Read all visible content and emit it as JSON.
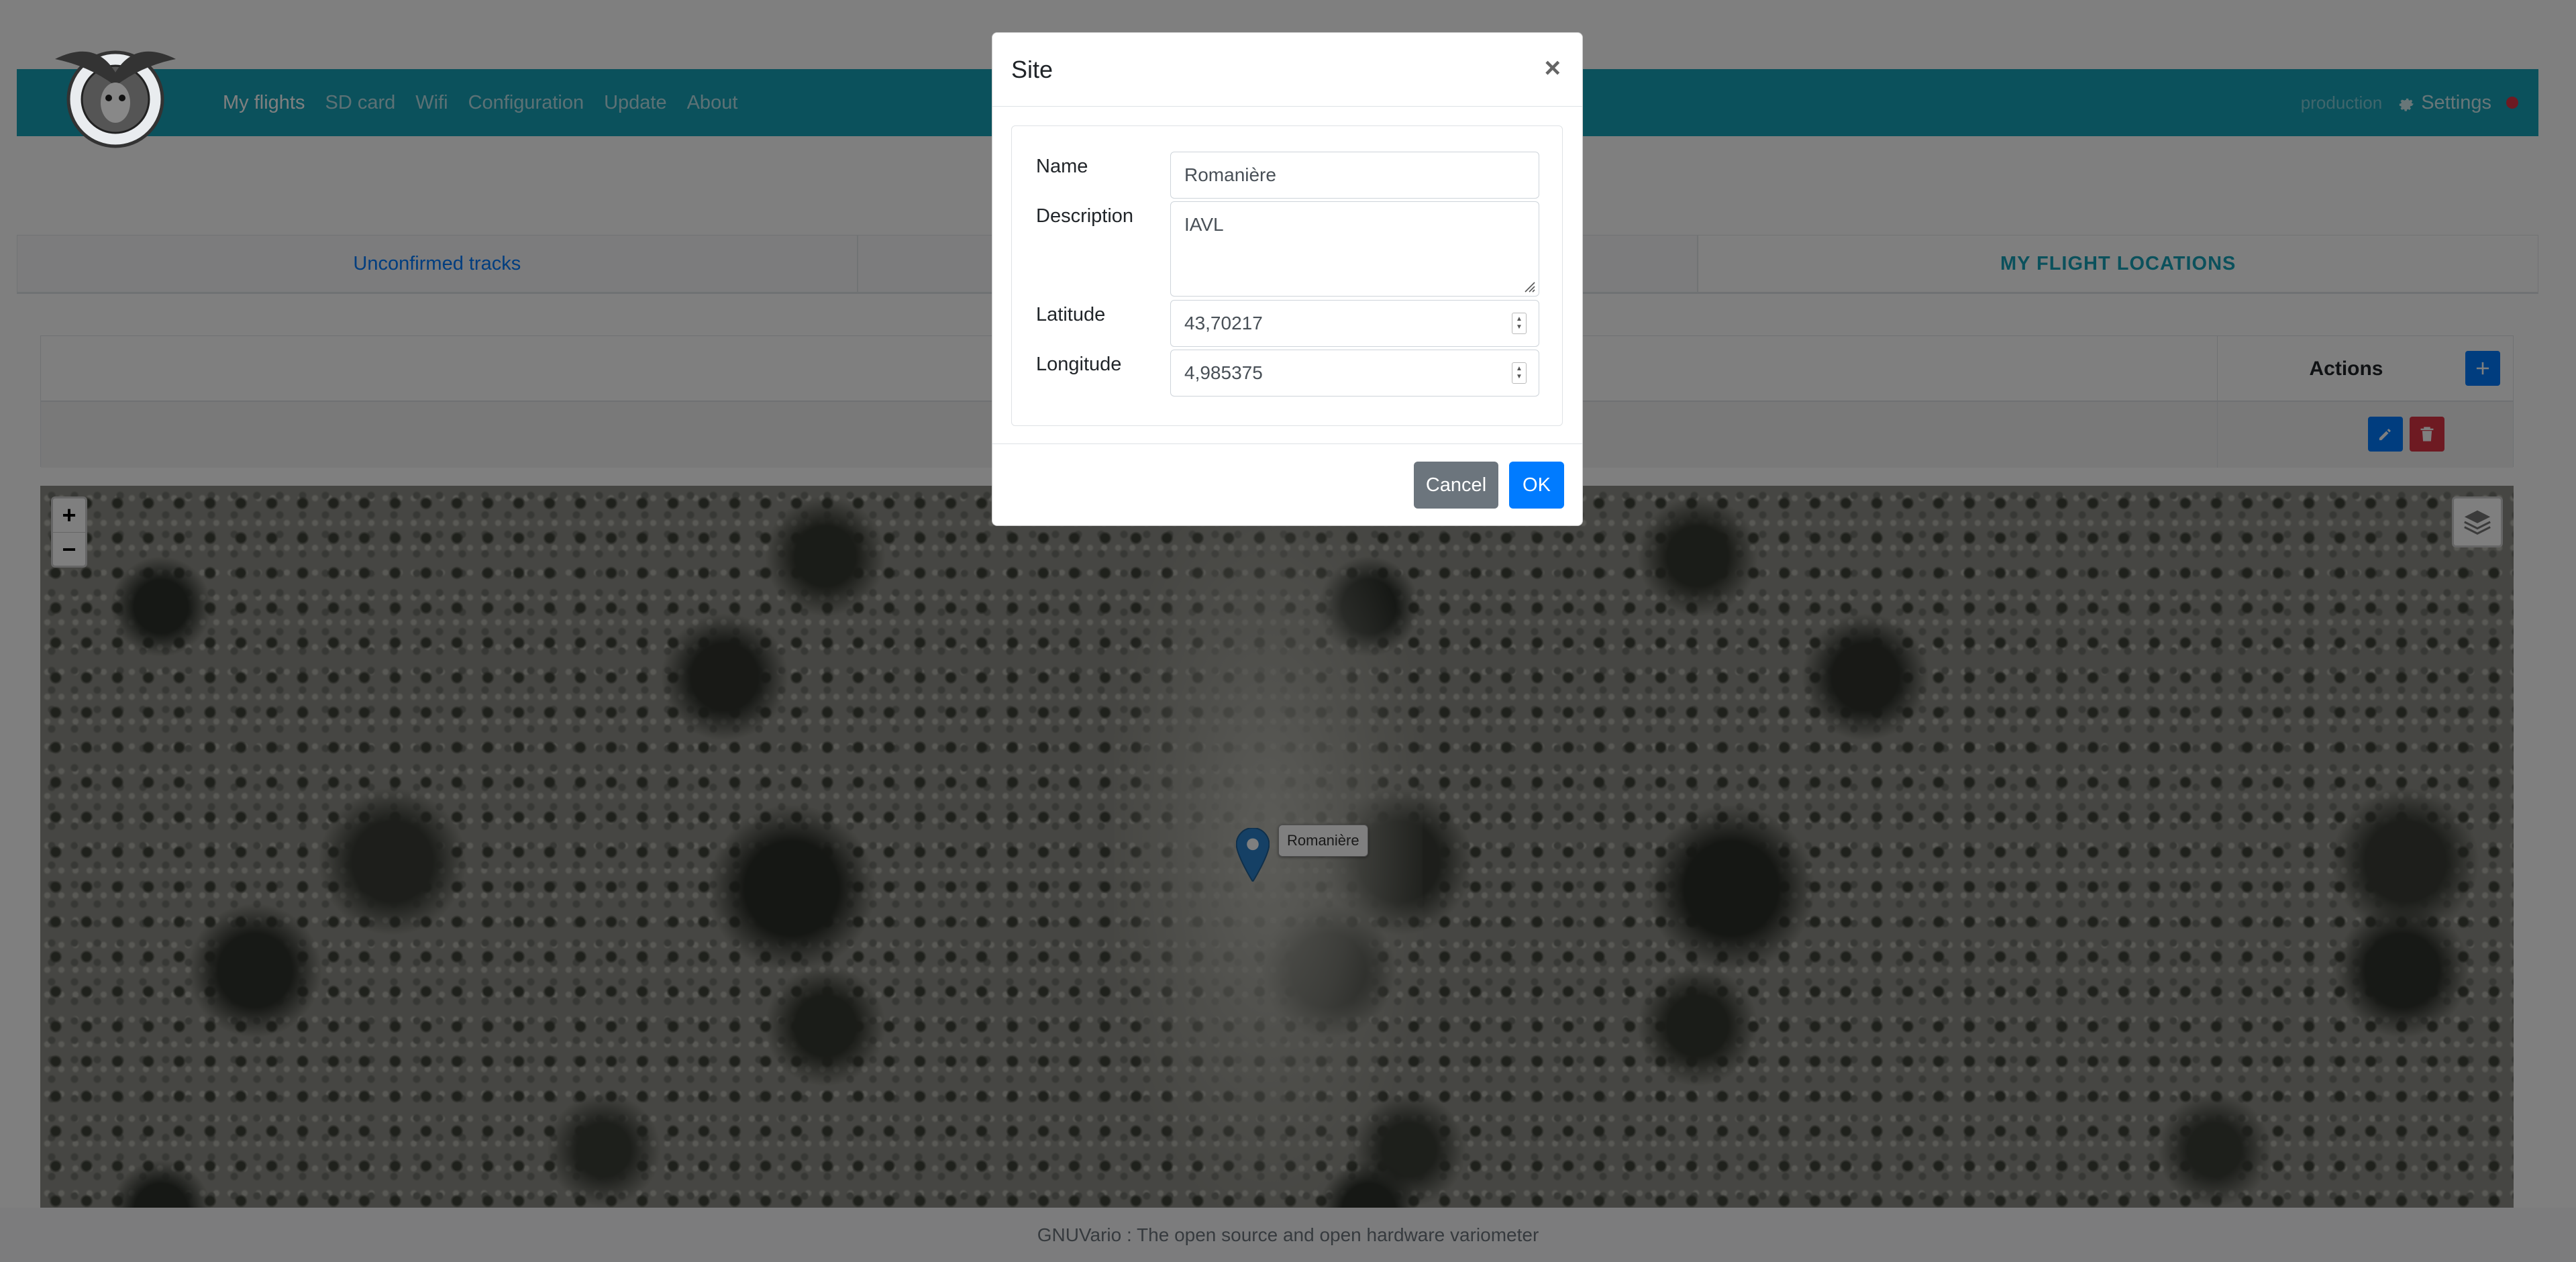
{
  "navbar": {
    "links": [
      "My flights",
      "SD card",
      "Wifi",
      "Configuration",
      "Update",
      "About"
    ],
    "active_link": "My flights",
    "env_label": "production",
    "settings_label": "Settings"
  },
  "tabs": [
    "Unconfirmed tracks",
    "",
    "MY FLIGHT LOCATIONS"
  ],
  "table": {
    "actions_header": "Actions",
    "add_icon": "plus-icon",
    "edit_icon": "pencil-icon",
    "delete_icon": "trash-icon"
  },
  "map": {
    "zoom_in": "+",
    "zoom_out": "−",
    "layers_icon": "layers-icon",
    "marker_icon": "map-marker-icon",
    "marker_label": "Romanière"
  },
  "footer": {
    "text": "GNUVario : The open source and open hardware variometer"
  },
  "modal": {
    "title": "Site",
    "close": "×",
    "fields": {
      "name": {
        "label": "Name",
        "value": "Romanière"
      },
      "description": {
        "label": "Description",
        "value": "IAVL"
      },
      "latitude": {
        "label": "Latitude",
        "value": "43,70217"
      },
      "longitude": {
        "label": "Longitude",
        "value": "4,985375"
      }
    },
    "cancel_label": "Cancel",
    "ok_label": "OK"
  },
  "colors": {
    "navbar": "#17a2b8",
    "primary": "#007bff",
    "danger": "#dc3545",
    "secondary": "#6c757d"
  }
}
